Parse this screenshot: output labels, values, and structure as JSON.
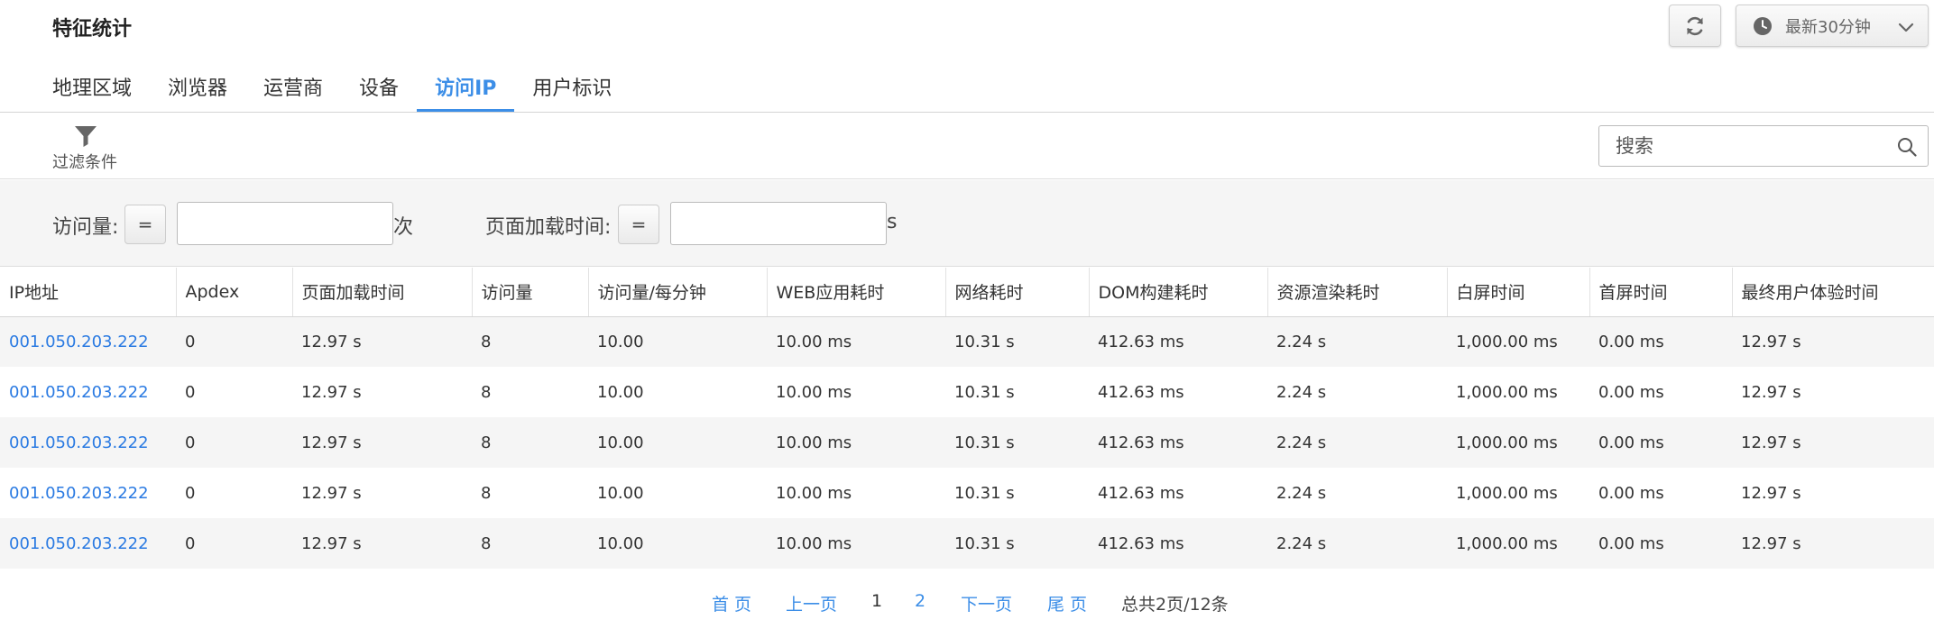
{
  "header": {
    "title": "特征统计",
    "refresh_icon": "refresh-icon",
    "time_range": {
      "icon": "clock-icon",
      "label": "最新30分钟"
    }
  },
  "tabs": [
    {
      "label": "地理区域",
      "active": false
    },
    {
      "label": "浏览器",
      "active": false
    },
    {
      "label": "运营商",
      "active": false
    },
    {
      "label": "设备",
      "active": false
    },
    {
      "label": "访问IP",
      "active": true
    },
    {
      "label": "用户标识",
      "active": false
    }
  ],
  "toolbar": {
    "filter_label": "过滤条件",
    "search_placeholder": "搜索"
  },
  "filters": {
    "visits": {
      "label": "访问量:",
      "operator": "=",
      "value": "",
      "unit": "次"
    },
    "load_time": {
      "label": "页面加载时间:",
      "operator": "=",
      "value": "",
      "unit": "s"
    }
  },
  "table": {
    "columns": [
      "IP地址",
      "Apdex",
      "页面加载时间",
      "访问量",
      "访问量/每分钟",
      "WEB应用耗时",
      "网络耗时",
      "DOM构建耗时",
      "资源渲染耗时",
      "白屏时间",
      "首屏时间",
      "最终用户体验时间"
    ],
    "rows": [
      [
        "001.050.203.222",
        "0",
        "12.97 s",
        "8",
        "10.00",
        "10.00 ms",
        "10.31 s",
        "412.63 ms",
        "2.24 s",
        "1,000.00 ms",
        "0.00 ms",
        "12.97 s"
      ],
      [
        "001.050.203.222",
        "0",
        "12.97 s",
        "8",
        "10.00",
        "10.00 ms",
        "10.31 s",
        "412.63 ms",
        "2.24 s",
        "1,000.00 ms",
        "0.00 ms",
        "12.97 s"
      ],
      [
        "001.050.203.222",
        "0",
        "12.97 s",
        "8",
        "10.00",
        "10.00 ms",
        "10.31 s",
        "412.63 ms",
        "2.24 s",
        "1,000.00 ms",
        "0.00 ms",
        "12.97 s"
      ],
      [
        "001.050.203.222",
        "0",
        "12.97 s",
        "8",
        "10.00",
        "10.00 ms",
        "10.31 s",
        "412.63 ms",
        "2.24 s",
        "1,000.00 ms",
        "0.00 ms",
        "12.97 s"
      ],
      [
        "001.050.203.222",
        "0",
        "12.97 s",
        "8",
        "10.00",
        "10.00 ms",
        "10.31 s",
        "412.63 ms",
        "2.24 s",
        "1,000.00 ms",
        "0.00 ms",
        "12.97 s"
      ]
    ]
  },
  "pagination": {
    "first": "首 页",
    "prev": "上一页",
    "pages": [
      "1",
      "2"
    ],
    "current_page": "1",
    "next": "下一页",
    "last": "尾 页",
    "total": "总共2页/12条"
  },
  "colors": {
    "accent": "#3c8ee7",
    "link": "#2a7ae2",
    "stripe": "#f5f5f5",
    "panel_bg": "#f5f5f5"
  }
}
